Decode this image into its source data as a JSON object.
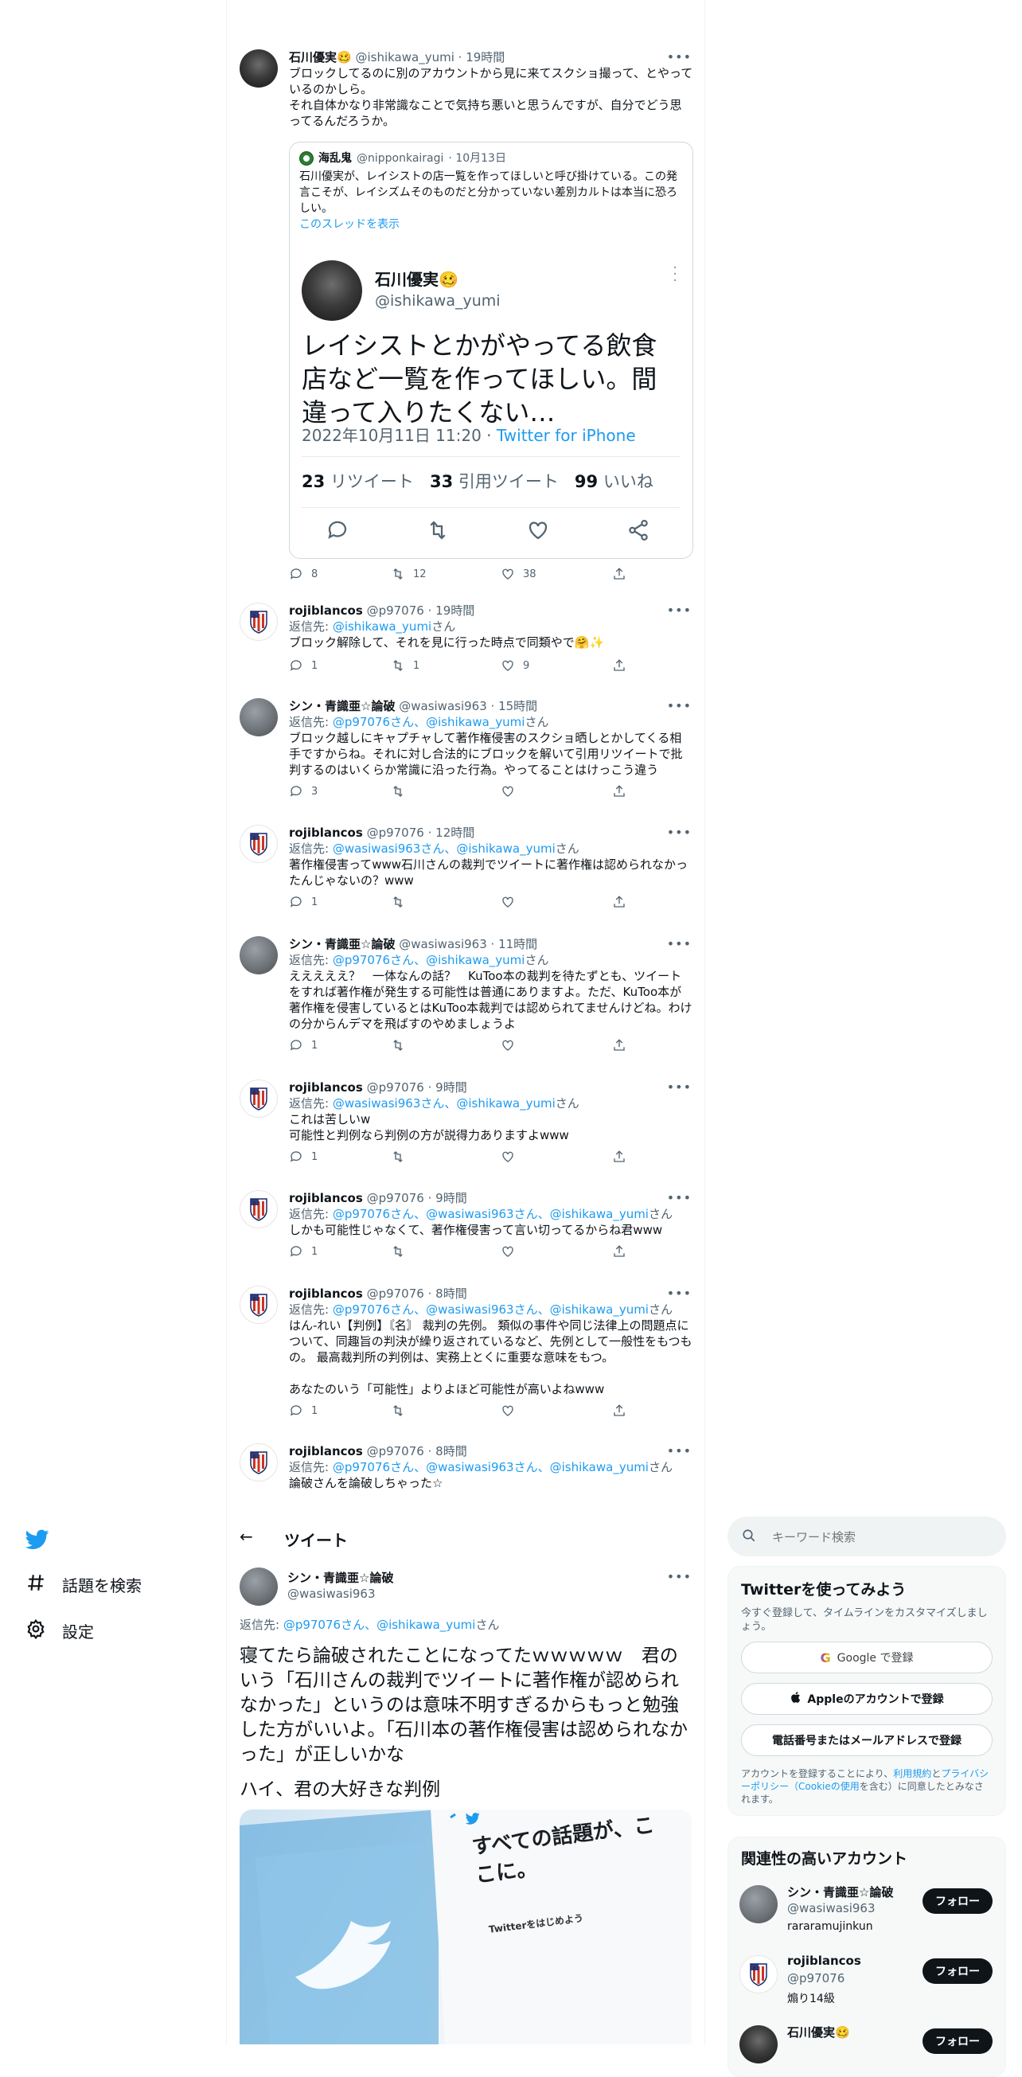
{
  "thread": {
    "first_tweet": {
      "name": "石川優実🥴",
      "handle": "@ishikawa_yumi",
      "time": "· 19時間",
      "text": "ブロックしてるのに別のアカウントから見に来てスクショ撮って、とやっているのかしら。\nそれ自体かなり非常識なことで気持ち悪いと思うんですが、自分でどう思ってるんだろうか。",
      "quote": {
        "name": "海乱鬼",
        "handle": "@nipponkairagi",
        "time": "· 10月13日",
        "text": "石川優実が、レイシストの店一覧を作ってほしいと呼び掛けている。この発言こそが、レイシズムそのものだと分かっていない差別カルトは本当に恐ろしい。",
        "show_thread": "このスレッドを表示",
        "card": {
          "name": "石川優実🥴",
          "handle": "@ishikawa_yumi",
          "text": "レイシストとかがやってる飲食店など一覧を作ってほしい。間違って入りたくない…",
          "date": "2022年10月11日 11:20",
          "source": "Twitter for iPhone",
          "retweets": "23",
          "retweets_label": "リツイート",
          "quotes": "33",
          "quotes_label": "引用ツイート",
          "likes": "99",
          "likes_label": "いいね"
        }
      },
      "counts": {
        "reply": "8",
        "retweet": "12",
        "like": "38"
      }
    },
    "replies": [
      {
        "name": "rojiblancos",
        "handle": "@p97076",
        "time": "· 19時間",
        "reply_prefix": "返信先: ",
        "reply_to": "@ishikawa_yumi",
        "reply_suffix": "さん",
        "text": "ブロック解除して、それを見に行った時点で同類やで🤗✨",
        "counts": {
          "reply": "1",
          "retweet": "1",
          "like": "9"
        }
      },
      {
        "name": "シン・青識亜☆論破",
        "handle": "@wasiwasi963",
        "time": "· 15時間",
        "reply_prefix": "返信先: ",
        "reply_to": "@p97076さん、@ishikawa_yumi",
        "reply_suffix": "さん",
        "text": "ブロック越しにキャプチャして著作権侵害のスクショ晒しとかしてくる相手ですからね。それに対し合法的にブロックを解いて引用リツイートで批判するのはいくらか常識に沿った行為。やってることはけっこう違う",
        "counts": {
          "reply": "3",
          "retweet": "",
          "like": ""
        }
      },
      {
        "name": "rojiblancos",
        "handle": "@p97076",
        "time": "· 12時間",
        "reply_prefix": "返信先: ",
        "reply_to": "@wasiwasi963さん、@ishikawa_yumi",
        "reply_suffix": "さん",
        "text": "著作権侵害ってwww石川さんの裁判でツイートに著作権は認められなかったんじゃないの？www",
        "counts": {
          "reply": "1",
          "retweet": "",
          "like": ""
        }
      },
      {
        "name": "シン・青識亜☆論破",
        "handle": "@wasiwasi963",
        "time": "· 11時間",
        "reply_prefix": "返信先: ",
        "reply_to": "@p97076さん、@ishikawa_yumi",
        "reply_suffix": "さん",
        "text": "えええええ？　一体なんの話？　KuToo本の裁判を待たずとも、ツイートをすれば著作権が発生する可能性は普通にありますよ。ただ、KuToo本が著作権を侵害しているとはKuToo本裁判では認められてませんけどね。わけの分からんデマを飛ばすのやめましょうよ",
        "counts": {
          "reply": "1",
          "retweet": "",
          "like": ""
        }
      },
      {
        "name": "rojiblancos",
        "handle": "@p97076",
        "time": "· 9時間",
        "reply_prefix": "返信先: ",
        "reply_to": "@wasiwasi963さん、@ishikawa_yumi",
        "reply_suffix": "さん",
        "text": "これは苦しいw\n可能性と判例なら判例の方が説得力ありますよwww",
        "counts": {
          "reply": "1",
          "retweet": "",
          "like": ""
        }
      },
      {
        "name": "rojiblancos",
        "handle": "@p97076",
        "time": "· 9時間",
        "reply_prefix": "返信先: ",
        "reply_to": "@p97076さん、@wasiwasi963さん、@ishikawa_yumi",
        "reply_suffix": "さん",
        "text": "しかも可能性じゃなくて、著作権侵害って言い切ってるからね君www",
        "counts": {
          "reply": "1",
          "retweet": "",
          "like": ""
        }
      },
      {
        "name": "rojiblancos",
        "handle": "@p97076",
        "time": "· 8時間",
        "reply_prefix": "返信先: ",
        "reply_to": "@p97076さん、@wasiwasi963さん、@ishikawa_yumi",
        "reply_suffix": "さん",
        "text": "はん‐れい【判例】〘名〙 裁判の先例。 類似の事件や同じ法律上の問題点について、同趣旨の判決が繰り返されているなど、先例として一般性をもつもの。 最高裁判所の判例は、実務上とくに重要な意味をもつ。\n\nあなたのいう「可能性」よりよほど可能性が高いよねwww",
        "counts": {
          "reply": "1",
          "retweet": "",
          "like": ""
        }
      },
      {
        "name": "rojiblancos",
        "handle": "@p97076",
        "time": "· 8時間",
        "reply_prefix": "返信先: ",
        "reply_to": "@p97076さん、@wasiwasi963さん、@ishikawa_yumi",
        "reply_suffix": "さん",
        "text": "論破さんを論破しちゃった☆",
        "counts": {
          "reply": "",
          "retweet": "",
          "like": ""
        }
      }
    ]
  },
  "nav": {
    "explore": "話題を検索",
    "settings": "設定"
  },
  "main": {
    "header_title": "ツイート",
    "tweet": {
      "name": "シン・青識亜☆論破",
      "handle": "@wasiwasi963",
      "reply_prefix": "返信先: ",
      "reply_to": "@p97076さん、@ishikawa_yumi",
      "reply_suffix": "さん",
      "text1": "寝てたら論破されたことになってたｗｗｗｗｗ　君のいう「石川さんの裁判でツイートに著作権が認められなかった」というのは意味不明すぎるからもっと勉強した方がいいよ。「石川本の著作権侵害は認められなかった」が正しいかな",
      "text2": "ハイ、君の大好きな判例",
      "image_headline": "すべての話題が、ここに。",
      "image_sub": "Twitterをはじめよう"
    }
  },
  "right": {
    "search_placeholder": "キーワード検索",
    "signup": {
      "title": "Twitterを使ってみよう",
      "desc": "今すぐ登録して、タイムラインをカスタマイズしましょう。",
      "google": "Google で登録",
      "apple": "Appleのアカウントで登録",
      "phone": "電話番号またはメールアドレスで登録",
      "legal_1": "アカウントを登録することにより、",
      "legal_link1": "利用規約",
      "legal_2": "と",
      "legal_link2": "プライバシーポリシー（Cookieの使用",
      "legal_3": "を含む）に同意したとみなされます。"
    },
    "related": {
      "title": "関連性の高いアカウント",
      "follow_label": "フォロー",
      "accounts": [
        {
          "name": "シン・青識亜☆論破",
          "handle": "@wasiwasi963",
          "bio": "rararamujinkun"
        },
        {
          "name": "rojiblancos",
          "handle": "@p97076",
          "bio": "煽り14級"
        },
        {
          "name": "石川優実🥴",
          "handle": "",
          "bio": ""
        }
      ]
    }
  },
  "colors": {
    "accent": "#1d9bf0",
    "text": "#0f1419",
    "muted": "#536471",
    "border": "#eff3f4"
  }
}
